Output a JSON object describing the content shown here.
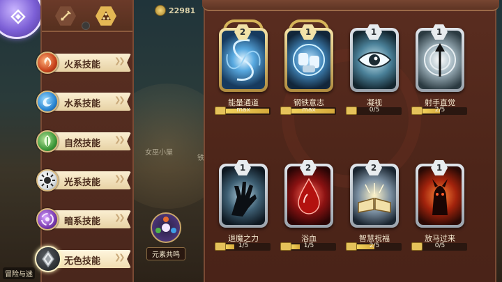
{
  "currency": {
    "amount": "22981",
    "icon": "coin-icon"
  },
  "background": {
    "building_label": "女巫小屋",
    "building_label_2": "铁",
    "adventure_label": "冒险与迷"
  },
  "filters": [
    {
      "icon": "crossed-swords-icon",
      "active": false
    },
    {
      "icon": "triangle-gems-icon",
      "active": true
    }
  ],
  "categories": [
    {
      "id": "fire",
      "label": "火系技能",
      "icon": "fire-orb-icon",
      "color": "#d24a1f"
    },
    {
      "id": "water",
      "label": "水系技能",
      "icon": "water-orb-icon",
      "color": "#2b8bd6"
    },
    {
      "id": "nature",
      "label": "自然技能",
      "icon": "leaf-orb-icon",
      "color": "#3e9a3a"
    },
    {
      "id": "light",
      "label": "光系技能",
      "icon": "sun-orb-icon",
      "color": "#f0f0f0"
    },
    {
      "id": "dark",
      "label": "暗系技能",
      "icon": "vortex-orb-icon",
      "color": "#7b3bb0"
    },
    {
      "id": "colorless",
      "label": "无色技能",
      "icon": "crystal-orb-icon",
      "color": "#9aa0a6",
      "selected": true
    }
  ],
  "resonance": {
    "label": "元素共鸣",
    "icon": "element-resonance-icon"
  },
  "skills": [
    {
      "name": "能量通道",
      "level": "2",
      "progress_text": "max",
      "progress": 1.0,
      "frame": "gold",
      "icon": "energy-vortex-icon"
    },
    {
      "name": "钢铁意志",
      "level": "1",
      "progress_text": "max",
      "progress": 1.0,
      "frame": "gold",
      "icon": "iron-fists-icon"
    },
    {
      "name": "凝视",
      "level": "1",
      "progress_text": "0/5",
      "progress": 0.0,
      "frame": "silver",
      "icon": "eye-icon"
    },
    {
      "name": "射手直觉",
      "level": "1",
      "progress_text": "2/5",
      "progress": 0.4,
      "frame": "silver",
      "icon": "arrow-target-icon"
    },
    {
      "name": "退魔之力",
      "level": "1",
      "progress_text": "1/5",
      "progress": 0.2,
      "frame": "silver",
      "icon": "dark-hand-icon"
    },
    {
      "name": "浴血",
      "level": "2",
      "progress_text": "1/5",
      "progress": 0.2,
      "frame": "silver",
      "icon": "blood-drop-icon"
    },
    {
      "name": "智慧祝福",
      "level": "2",
      "progress_text": "2/5",
      "progress": 0.4,
      "frame": "silver",
      "icon": "open-book-icon"
    },
    {
      "name": "放马过来",
      "level": "1",
      "progress_text": "0/5",
      "progress": 0.0,
      "frame": "silver",
      "icon": "taunting-demon-icon"
    }
  ]
}
